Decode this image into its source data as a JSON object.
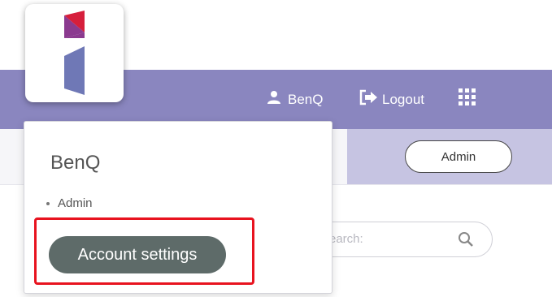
{
  "header": {
    "user_name": "BenQ",
    "user_icon": "user-icon",
    "logout_label": "Logout",
    "logout_icon": "logout-icon",
    "apps_icon": "grid-apps-icon",
    "background_color": "#8a86bf"
  },
  "subbar": {
    "admin_label": "Admin",
    "accent_color": "#c6c4e2"
  },
  "search": {
    "placeholder_visible": "earch:",
    "icon": "search-icon"
  },
  "logo": {
    "icon": "benq-logo-icon",
    "colors": [
      "#d61f3c",
      "#8b3a8f",
      "#6f78b6"
    ]
  },
  "dropdown": {
    "user_name": "BenQ",
    "roles": [
      "Admin"
    ],
    "account_settings_label": "Account settings",
    "button_color": "#5e6b69"
  },
  "highlight": {
    "color": "#e8131f"
  }
}
